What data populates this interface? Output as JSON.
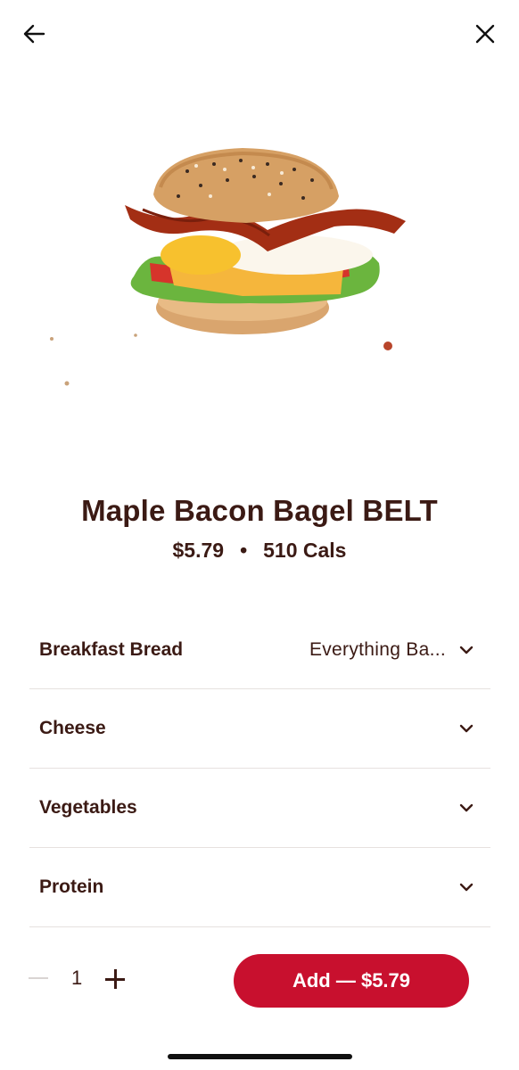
{
  "nav": {
    "back_icon": "arrow-left-icon",
    "close_icon": "close-icon"
  },
  "product": {
    "name": "Maple Bacon Bagel BELT",
    "price": "$5.79",
    "separator": "•",
    "calories": "510 Cals",
    "image": "bagel-sandwich-image"
  },
  "options": [
    {
      "label": "Breakfast Bread",
      "value": "Everything Ba..."
    },
    {
      "label": "Cheese",
      "value": ""
    },
    {
      "label": "Vegetables",
      "value": ""
    },
    {
      "label": "Protein",
      "value": ""
    }
  ],
  "footer": {
    "quantity": "1",
    "add_label": "Add — $5.79"
  },
  "colors": {
    "accent": "#c8102e",
    "text": "#3b1a14",
    "divider": "#e6e1df"
  }
}
